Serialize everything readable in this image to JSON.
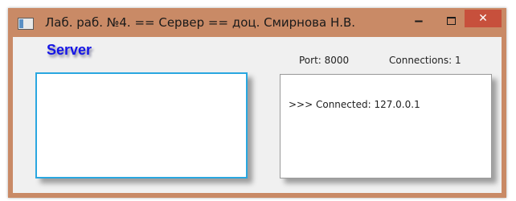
{
  "window": {
    "title": "Лаб. раб. №4. == Сервер == доц. Смирнова Н.В.",
    "controls": {
      "minimize": "‒",
      "close": "✕"
    }
  },
  "main": {
    "server_label": "Server",
    "port": "Port: 8000",
    "connections": "Connections:  1",
    "log": [
      ">>> Connected: 127.0.0.1"
    ]
  },
  "colors": {
    "titlebar": "#c98a66",
    "close_button": "#c7503c",
    "server_label": "#1515e6",
    "input_focus_border": "#2aa7e0"
  },
  "icons": {
    "app": "app-icon",
    "minimize": "minimize-icon",
    "maximize": "maximize-icon",
    "close": "close-icon"
  }
}
